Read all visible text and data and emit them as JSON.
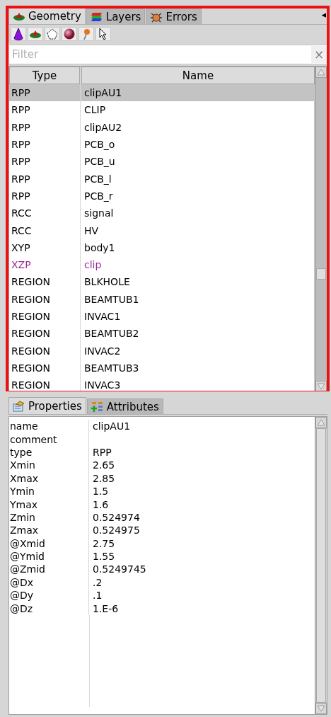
{
  "geometry_panel": {
    "tabs": [
      {
        "label": "Geometry",
        "selected": true
      },
      {
        "label": "Layers",
        "selected": false
      },
      {
        "label": "Errors",
        "selected": false
      }
    ],
    "collapse": "◂",
    "filter": {
      "placeholder": "Filter",
      "clear": "×"
    },
    "table": {
      "columns": [
        "Type",
        "Name"
      ],
      "rows": [
        {
          "type": "RPP",
          "name": "clipAU1",
          "selected": true,
          "color": "#000000"
        },
        {
          "type": "RPP",
          "name": "CLIP",
          "selected": false,
          "color": "#000000"
        },
        {
          "type": "RPP",
          "name": "clipAU2",
          "selected": false,
          "color": "#000000"
        },
        {
          "type": "RPP",
          "name": "PCB_o",
          "selected": false,
          "color": "#000000"
        },
        {
          "type": "RPP",
          "name": "PCB_u",
          "selected": false,
          "color": "#000000"
        },
        {
          "type": "RPP",
          "name": "PCB_l",
          "selected": false,
          "color": "#000000"
        },
        {
          "type": "RPP",
          "name": "PCB_r",
          "selected": false,
          "color": "#000000"
        },
        {
          "type": "RCC",
          "name": "signal",
          "selected": false,
          "color": "#000000"
        },
        {
          "type": "RCC",
          "name": "HV",
          "selected": false,
          "color": "#000000"
        },
        {
          "type": "XYP",
          "name": "body1",
          "selected": false,
          "color": "#000000"
        },
        {
          "type": "XZP",
          "name": "clip",
          "selected": false,
          "color": "#9a2d9a"
        },
        {
          "type": "REGION",
          "name": "BLKHOLE",
          "selected": false,
          "color": "#000000"
        },
        {
          "type": "REGION",
          "name": "BEAMTUB1",
          "selected": false,
          "color": "#000000"
        },
        {
          "type": "REGION",
          "name": "INVAC1",
          "selected": false,
          "color": "#000000"
        },
        {
          "type": "REGION",
          "name": "BEAMTUB2",
          "selected": false,
          "color": "#000000"
        },
        {
          "type": "REGION",
          "name": "INVAC2",
          "selected": false,
          "color": "#000000"
        },
        {
          "type": "REGION",
          "name": "BEAMTUB3",
          "selected": false,
          "color": "#000000"
        },
        {
          "type": "REGION",
          "name": "INVAC3",
          "selected": false,
          "color": "#000000"
        }
      ]
    }
  },
  "properties_panel": {
    "tabs": [
      {
        "label": "Properties",
        "selected": true
      },
      {
        "label": "Attributes",
        "selected": false
      }
    ],
    "rows": [
      {
        "key": "name",
        "value": "clipAU1"
      },
      {
        "key": "comment"
      },
      {
        "key": "type",
        "value": "RPP"
      },
      {
        "key": "Xmin",
        "value": "2.65"
      },
      {
        "key": "Xmax",
        "value": "2.85"
      },
      {
        "key": "Ymin",
        "value": "1.5"
      },
      {
        "key": "Ymax",
        "value": "1.6"
      },
      {
        "key": "Zmin",
        "value": "0.524974"
      },
      {
        "key": "Zmax",
        "value": "0.524975"
      },
      {
        "key": "@Xmid",
        "value": "2.75"
      },
      {
        "key": "@Ymid",
        "value": "1.55"
      },
      {
        "key": "@Zmid",
        "value": "0.5249745"
      },
      {
        "key": "@Dx",
        "value": ".2"
      },
      {
        "key": "@Dy",
        "value": ".1"
      },
      {
        "key": "@Dz",
        "value": "1.E-6"
      }
    ]
  }
}
